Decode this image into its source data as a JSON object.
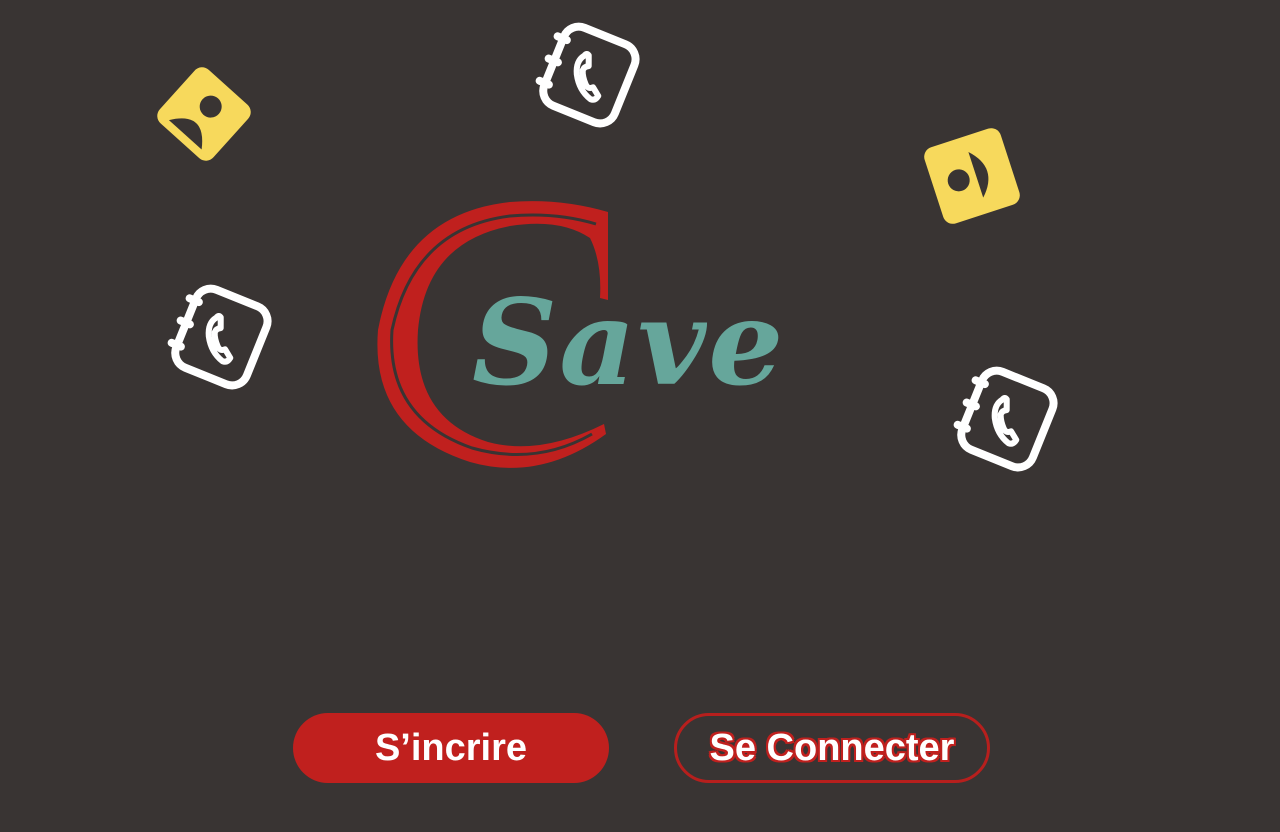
{
  "app": {
    "logo_initial": "C",
    "logo_word": "Save"
  },
  "actions": {
    "signup_label": "S’incrire",
    "login_label": "Se Connecter"
  },
  "decorations": {
    "icons": [
      "contact-card-icon",
      "phone-book-icon",
      "contact-card-icon",
      "phone-book-icon",
      "phone-book-icon"
    ]
  },
  "colors": {
    "background": "#393433",
    "brand_red": "#c0201e",
    "brand_teal": "#66a69b",
    "accent_yellow": "#f7d95c",
    "icon_white": "#ffffff"
  }
}
